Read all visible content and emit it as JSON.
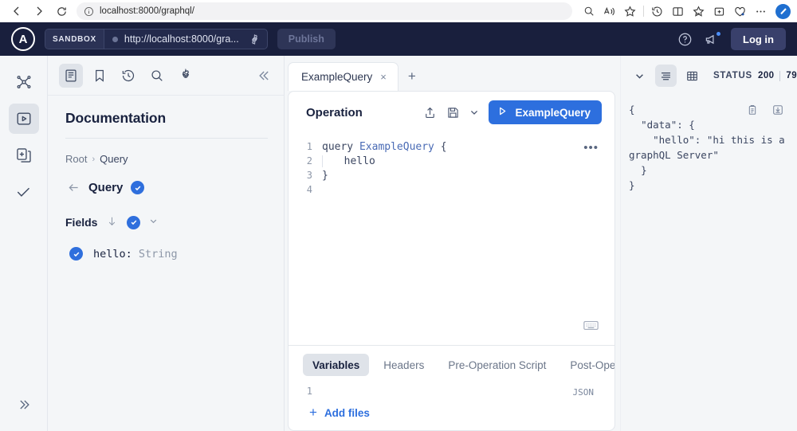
{
  "browser": {
    "back_icon": "back-arrow-icon",
    "forward_icon": "forward-arrow-icon",
    "reload_icon": "reload-icon",
    "info_icon": "site-info-icon",
    "url_host": "localhost:8000",
    "url_path": "/graphql/",
    "url_full": "localhost:8000/graphql/",
    "toolbar_icons": [
      "search-icon",
      "read-aloud-icon",
      "favorite-star-icon",
      "history-icon",
      "split-screen-icon",
      "collections-icon",
      "browser-extensions-icon",
      "browser-essentials-icon",
      "more-options-icon"
    ],
    "profile_initial": ""
  },
  "header": {
    "logo_letter": "A",
    "sandbox_badge": "SANDBOX",
    "endpoint_url": "http://localhost:8000/gra...",
    "gear_icon": "settings-gear-icon",
    "publish_label": "Publish",
    "help_icon": "help-circle-icon",
    "announcements_icon": "megaphone-icon",
    "login_label": "Log in",
    "bg_color": "#191f3d",
    "accent_color": "#2d6fde"
  },
  "rail": {
    "items": [
      {
        "name": "graph-schema-icon",
        "label": "Schema"
      },
      {
        "name": "explorer-play-icon",
        "label": "Explorer",
        "active": true
      },
      {
        "name": "changelog-icon",
        "label": "Changelog"
      },
      {
        "name": "checks-icon",
        "label": "Checks"
      }
    ],
    "expand_label": "»"
  },
  "docs": {
    "toolbar": [
      {
        "name": "documentation-icon",
        "label": "Documentation",
        "active": true
      },
      {
        "name": "bookmark-icon",
        "label": "Saved operations"
      },
      {
        "name": "history-icon",
        "label": "History"
      },
      {
        "name": "search-icon",
        "label": "Search"
      },
      {
        "name": "settings-gear-icon",
        "label": "Settings"
      }
    ],
    "collapse_label": "«",
    "title": "Documentation",
    "breadcrumb": [
      "Root",
      "Query"
    ],
    "breadcrumb_sep": "›",
    "type_name": "Query",
    "fields_label": "Fields",
    "sort_arrow": "↓",
    "chevron": "⌄",
    "fields": [
      {
        "name": "hello",
        "type": "String",
        "separator": ": ",
        "selected": true
      }
    ]
  },
  "editor": {
    "tabs": [
      {
        "label": "ExampleQuery",
        "close": "×",
        "active": true
      }
    ],
    "new_tab": "+",
    "operation_title": "Operation",
    "share_icon": "share-upload-icon",
    "save_icon": "save-floppy-icon",
    "save_chevron": "⌄",
    "run_label": "ExampleQuery",
    "run_play": "▷",
    "code_menu": "•••",
    "keyboard_icon": "keyboard-shortcuts-icon",
    "lines": [
      {
        "n": "1",
        "text": "query ExampleQuery {",
        "kw": "query ",
        "name": "ExampleQuery",
        "tail": " {"
      },
      {
        "n": "2",
        "text": "  hello",
        "indent": true
      },
      {
        "n": "3",
        "text": "}"
      },
      {
        "n": "4",
        "text": ""
      }
    ]
  },
  "variables": {
    "tabs": [
      {
        "label": "Variables",
        "active": true
      },
      {
        "label": "Headers",
        "active": false
      },
      {
        "label": "Pre-Operation Script",
        "active": false
      },
      {
        "label": "Post-Opera",
        "active": false
      }
    ],
    "line_number": "1",
    "format_label": "JSON",
    "add_files_label": "Add files",
    "add_files_plus": "+"
  },
  "response": {
    "collapse_chevron": "⌄",
    "json_view_icon": "json-view-icon",
    "table_view_icon": "table-view-icon",
    "status_label": "STATUS",
    "status_code": "200",
    "status_time": "79",
    "copy_icon": "copy-clipboard-icon",
    "download_icon": "download-icon",
    "body_lines": [
      "{",
      "  \"data\": {",
      "    \"hello\": \"hi this is a graphQL Server\"",
      "  }",
      "}"
    ],
    "body_text": "{\n  \"data\": {\n    \"hello\": \"hi this is a graphQL Server\"\n  }\n}"
  }
}
